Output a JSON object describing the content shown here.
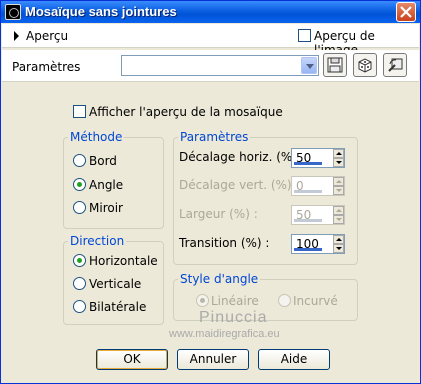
{
  "window": {
    "title": "Mosaïque sans jointures"
  },
  "preview_bar": {
    "label": "Aperçu",
    "image_preview_label": "Aperçu de l'image",
    "image_preview_checked": false
  },
  "params_bar": {
    "label": "Paramètres",
    "preset_value": ""
  },
  "show_mosaic": {
    "label": "Afficher l'aperçu de la mosaïque",
    "checked": false
  },
  "method": {
    "legend": "Méthode",
    "options": [
      {
        "label": "Bord",
        "selected": false
      },
      {
        "label": "Angle",
        "selected": true
      },
      {
        "label": "Miroir",
        "selected": false
      }
    ]
  },
  "direction": {
    "legend": "Direction",
    "options": [
      {
        "label": "Horizontale",
        "selected": true
      },
      {
        "label": "Verticale",
        "selected": false
      },
      {
        "label": "Bilatérale",
        "selected": false
      }
    ]
  },
  "params": {
    "legend": "Paramètres",
    "fields": [
      {
        "label": "Décalage horiz. (%) :",
        "value": "50",
        "enabled": true
      },
      {
        "label": "Décalage vert. (%) :",
        "value": "0",
        "enabled": false
      },
      {
        "label": "Largeur (%) :",
        "value": "50",
        "enabled": false
      },
      {
        "label": "Transition (%) :",
        "value": "100",
        "enabled": true
      }
    ]
  },
  "corner_style": {
    "legend": "Style d'angle",
    "options": [
      {
        "label": "Linéaire",
        "selected": true,
        "enabled": false
      },
      {
        "label": "Incurvé",
        "selected": false,
        "enabled": false
      }
    ]
  },
  "watermark": {
    "line1": "Pinuccia",
    "line2": "www.maidiregrafica.eu"
  },
  "buttons": {
    "ok": "OK",
    "cancel": "Annuler",
    "help": "Aide"
  },
  "colors": {
    "titlebar": "#0a5fe0",
    "dialog_bg": "#ece9d8",
    "legend_text": "#0046d5",
    "radio_dot": "#21a121"
  }
}
